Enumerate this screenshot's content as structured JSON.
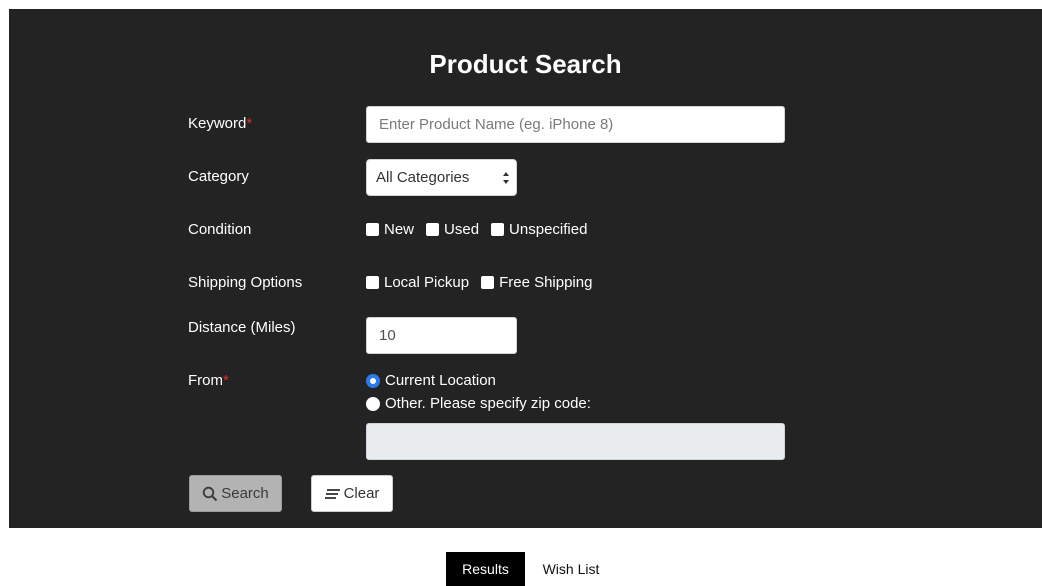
{
  "form": {
    "title": "Product Search",
    "keyword": {
      "label": "Keyword",
      "required_mark": "*",
      "placeholder": "Enter Product Name (eg. iPhone 8)",
      "value": ""
    },
    "category": {
      "label": "Category",
      "selected": "All Categories"
    },
    "condition": {
      "label": "Condition",
      "options": [
        "New",
        "Used",
        "Unspecified"
      ]
    },
    "shipping": {
      "label": "Shipping Options",
      "options": [
        "Local Pickup",
        "Free Shipping"
      ]
    },
    "distance": {
      "label": "Distance (Miles)",
      "value": "10"
    },
    "from": {
      "label": "From",
      "required_mark": "*",
      "options": [
        "Current Location",
        "Other. Please specify zip code:"
      ],
      "selected_index": 0,
      "zip_value": ""
    },
    "buttons": {
      "search": "Search",
      "clear": "Clear"
    }
  },
  "tabs": {
    "results": "Results",
    "wish_list": "Wish List",
    "active": "Results"
  },
  "colors": {
    "panel_bg": "#232323",
    "required": "#d9342b",
    "radio_selected": "#2b7bea",
    "active_tab": "#000000"
  }
}
